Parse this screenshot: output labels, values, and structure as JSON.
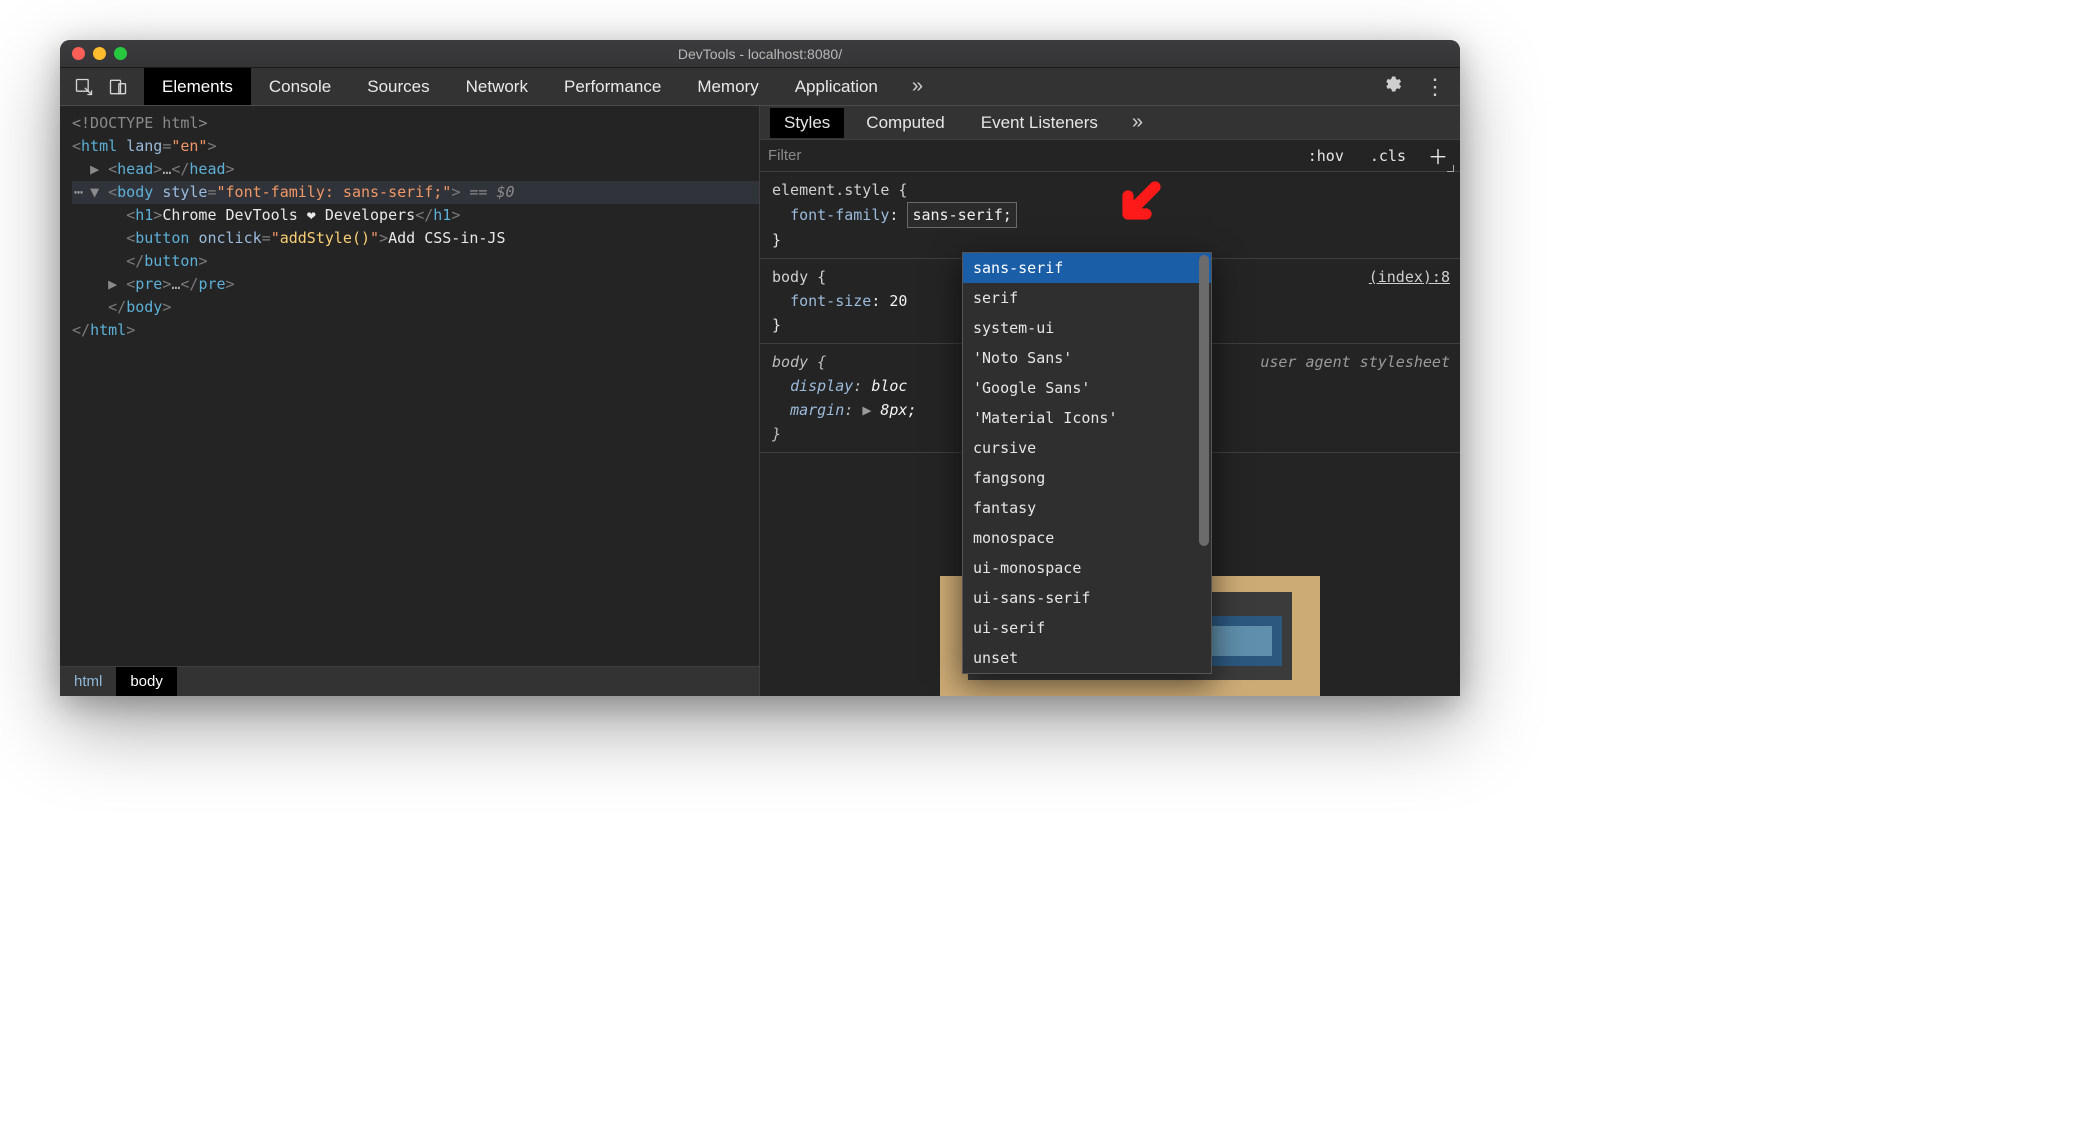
{
  "window": {
    "title": "DevTools - localhost:8080/"
  },
  "toolbar": {
    "tabs": [
      "Elements",
      "Console",
      "Sources",
      "Network",
      "Performance",
      "Memory",
      "Application"
    ],
    "activeTab": "Elements"
  },
  "dom": {
    "doctype": "<!DOCTYPE html>",
    "htmlOpen": {
      "tag": "html",
      "attrName": "lang",
      "attrVal": "\"en\""
    },
    "headCollapsed": "…",
    "bodyOpen": {
      "tag": "body",
      "attrName": "style",
      "attrVal": "\"font-family: sans-serif;\"",
      "trailer": " == $0"
    },
    "h1": {
      "tag": "h1",
      "text": "Chrome DevTools ❤ Developers"
    },
    "button": {
      "tag": "button",
      "attrName": "onclick",
      "attrVal": "\"addStyle()\"",
      "text": "Add CSS-in-JS"
    },
    "pre": {
      "tag": "pre",
      "collapsed": "…"
    },
    "bodyClose": "</body>",
    "htmlClose": "</html>"
  },
  "breadcrumb": {
    "items": [
      "html",
      "body"
    ],
    "active": "body"
  },
  "sidepanel": {
    "subtabs": [
      "Styles",
      "Computed",
      "Event Listeners"
    ],
    "activeSubtab": "Styles",
    "filterPlaceholder": "Filter",
    "hov": ":hov",
    "cls": ".cls"
  },
  "styles": {
    "rule1": {
      "selector": "element.style {",
      "propName": "font-family",
      "propValEditing": "sans-serif;",
      "close": "}"
    },
    "rule2": {
      "selector": "body {",
      "propName": "font-size",
      "propVal": "20",
      "close": "}",
      "link": "(index):8"
    },
    "rule3": {
      "selector": "body {",
      "p1n": "display",
      "p1v": "bloc",
      "p2n": "margin",
      "p2v": "8px;",
      "close": "}",
      "ua": "user agent stylesheet"
    }
  },
  "autocomplete": {
    "options": [
      "sans-serif",
      "serif",
      "system-ui",
      "'Noto Sans'",
      "'Google Sans'",
      "'Material Icons'",
      "cursive",
      "fangsong",
      "fantasy",
      "monospace",
      "ui-monospace",
      "ui-sans-serif",
      "ui-serif",
      "unset"
    ],
    "selected": "sans-serif"
  }
}
